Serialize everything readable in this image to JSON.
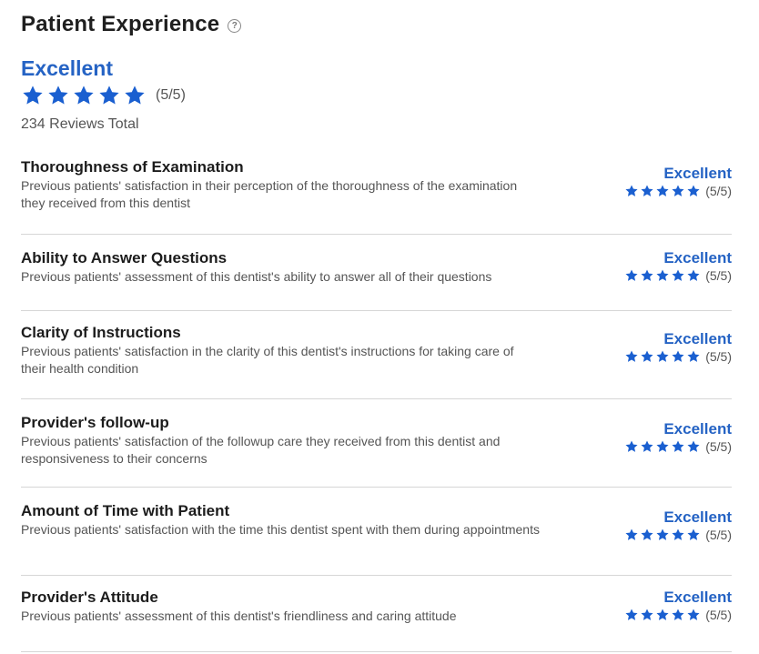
{
  "header": {
    "title": "Patient Experience",
    "help_icon": "question-circle-icon"
  },
  "overall": {
    "rating_label": "Excellent",
    "stars_filled": 5,
    "stars_total": 5,
    "score_text": "(5/5)",
    "reviews_total": "234 Reviews Total"
  },
  "colors": {
    "accent": "#2563c4",
    "star": "#1a5fd0"
  },
  "categories": [
    {
      "title": "Thoroughness of Examination",
      "description": "Previous patients' satisfaction in their perception of the thoroughness of the examination they received from this dentist",
      "rating_label": "Excellent",
      "stars_filled": 5,
      "score_text": "(5/5)"
    },
    {
      "title": "Ability to Answer Questions",
      "description": "Previous patients' assessment of this dentist's ability to answer all of their questions",
      "rating_label": "Excellent",
      "stars_filled": 5,
      "score_text": "(5/5)"
    },
    {
      "title": "Clarity of Instructions",
      "description": "Previous patients' satisfaction in the clarity of this dentist's instructions for taking care of their health condition",
      "rating_label": "Excellent",
      "stars_filled": 5,
      "score_text": "(5/5)"
    },
    {
      "title": "Provider's follow-up",
      "description": "Previous patients' satisfaction of the followup care they received from this dentist and responsiveness to their concerns",
      "rating_label": "Excellent",
      "stars_filled": 5,
      "score_text": "(5/5)"
    },
    {
      "title": "Amount of Time with Patient",
      "description": "Previous patients' satisfaction with the time this dentist spent with them during appointments",
      "rating_label": "Excellent",
      "stars_filled": 5,
      "score_text": "(5/5)"
    },
    {
      "title": "Provider's Attitude",
      "description": "Previous patients' assessment of this dentist's friendliness and caring attitude",
      "rating_label": "Excellent",
      "stars_filled": 5,
      "score_text": "(5/5)"
    }
  ]
}
